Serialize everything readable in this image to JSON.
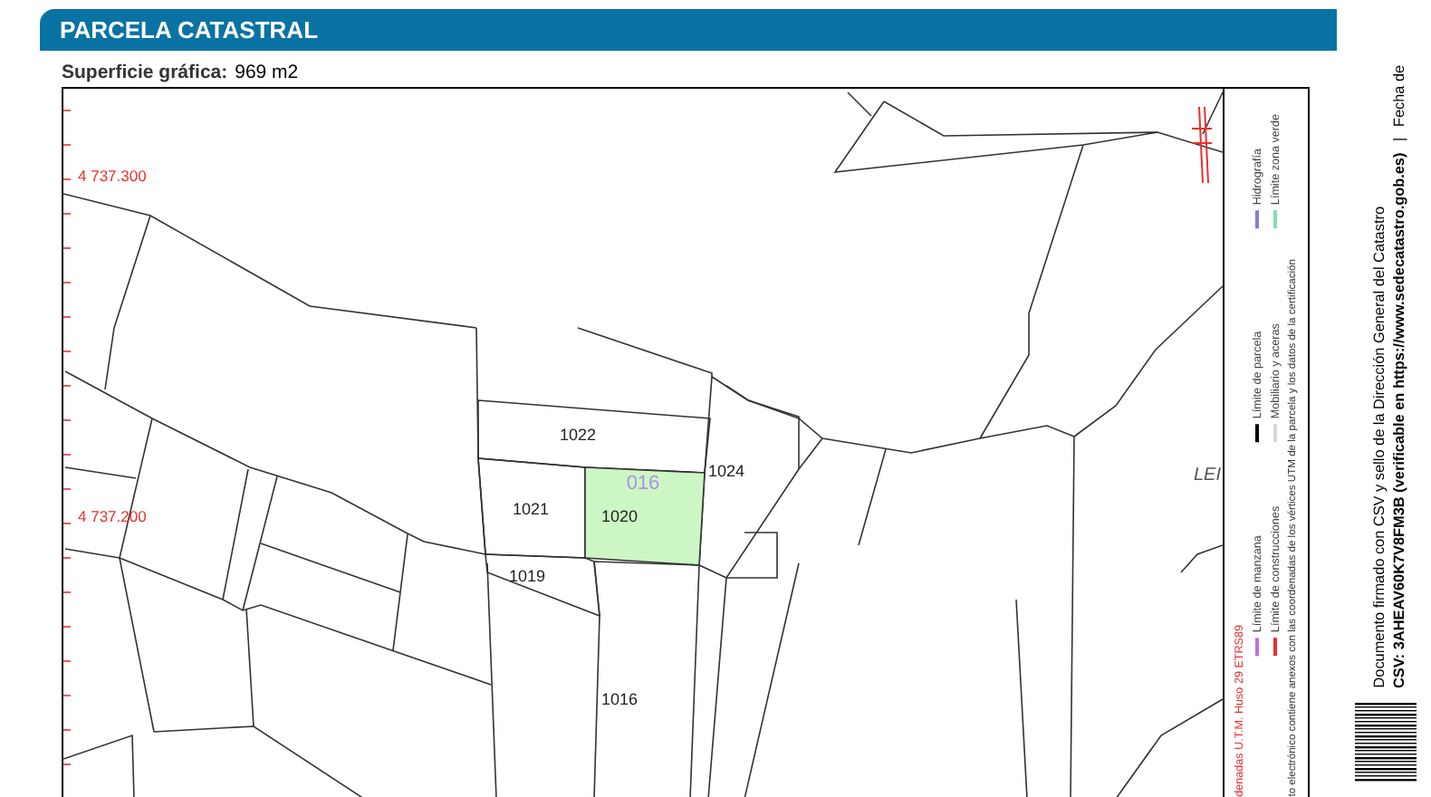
{
  "section": {
    "title": "PARCELA CATASTRAL"
  },
  "surface": {
    "label": "Superficie gráfica:",
    "value": "969 m2"
  },
  "map": {
    "coordinates": [
      {
        "label": "4 737.300"
      },
      {
        "label": "4 737.200"
      }
    ],
    "parcels": [
      {
        "label": "1022",
        "selected": false
      },
      {
        "label": "1024",
        "selected": false
      },
      {
        "label": "1021",
        "selected": false
      },
      {
        "label": "1020",
        "selected": true
      },
      {
        "label": "1019",
        "selected": false
      },
      {
        "label": "1016",
        "selected": false
      }
    ],
    "block_label": "016",
    "street_label": "LEI"
  },
  "legend": {
    "projection": "denadas U.T.M. Huso 29 ETRS89",
    "items": [
      {
        "label": "Límite de manzana",
        "color": "#c070e8"
      },
      {
        "label": "Límite de parcela",
        "color": "#000000"
      },
      {
        "label": "Hidrografía",
        "color": "#8080e0"
      },
      {
        "label": "Límite de construcciones",
        "color": "#e83030"
      },
      {
        "label": "Mobiliario y aceras",
        "color": "#d8d8d8"
      },
      {
        "label": "Límite zona verde",
        "color": "#80e0b0"
      }
    ],
    "note": "to electrónico contiene anexos con las coordenadas de los vértices UTM de la parcela y los datos de la certificación"
  },
  "signature": {
    "line_1": "Documento firmado con CSV y sello de la Dirección General del Catastro",
    "line_2": "CSV: 3AHEAV60K7V8FM3B (verificable en https://www.sedecatastro.gob.es)",
    "separator": "|",
    "date_label": "Fecha de"
  }
}
